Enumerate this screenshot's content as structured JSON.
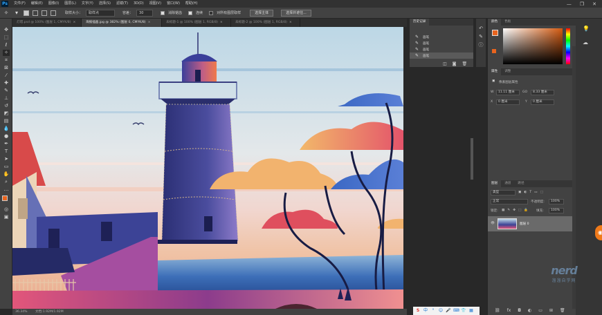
{
  "app": {
    "logo": "Ps"
  },
  "menu": [
    "文件(F)",
    "编辑(E)",
    "图像(I)",
    "图层(L)",
    "文字(Y)",
    "选择(S)",
    "滤镜(T)",
    "3D(D)",
    "视图(V)",
    "窗口(W)",
    "帮助(H)"
  ],
  "window_controls": [
    "—",
    "❐",
    "✕"
  ],
  "options": {
    "sample_size_label": "取样大小：",
    "sample_size_value": "取样点",
    "tolerance_label": "容差：",
    "tolerance_value": "30",
    "anti_alias": "消除锯齿",
    "contiguous": "连续",
    "sample_all_layers": "对所有图层取样",
    "subject_button": "选择主体",
    "select_mask_button": "选择并遮住..."
  },
  "tabs": [
    {
      "label": "灯塔.psd @ 100% (图层 1, CMYK/8)",
      "active": false
    },
    {
      "label": "海报插画.jpg @ 382% (图层 0, CMYK/8)",
      "active": true
    },
    {
      "label": "未标题-1 @ 100% (图层 1, RGB/8)",
      "active": false
    },
    {
      "label": "未标题-2 @ 100% (图层 1, RGB/8)",
      "active": false
    }
  ],
  "history": {
    "tabs": [
      "历史记录"
    ],
    "items": [
      "画笔",
      "画笔",
      "画笔",
      "画笔"
    ],
    "active_index": 3
  },
  "color_panel": {
    "tabs": [
      "颜色",
      "色板"
    ],
    "fg": "#e8641e",
    "bg": "#e8641e",
    "hue_sample": "#d45a10"
  },
  "properties": {
    "tabs": [
      "属性",
      "调整"
    ],
    "title": "像素图层属性",
    "w_label": "W",
    "w_value": "11.11 厘米",
    "go_label": "GO",
    "h_value": "8.33 厘米",
    "x_label": "X",
    "x_value": "0 厘米",
    "y_label": "Y",
    "y_value": "0 厘米"
  },
  "layers": {
    "tabs": [
      "图层",
      "通道",
      "路径"
    ],
    "filter_label": "类型",
    "blend_mode": "正常",
    "opacity_label": "不透明度:",
    "opacity_value": "100%",
    "lock_label": "锁定:",
    "fill_label": "填充:",
    "fill_value": "100%",
    "layer_name": "图层 0"
  },
  "status": {
    "zoom": "36.34%",
    "doc": "文档:1.92M/1.92M"
  },
  "watermark": {
    "big": "nerd",
    "small": "溜溜自学网"
  },
  "float_button": "◉"
}
